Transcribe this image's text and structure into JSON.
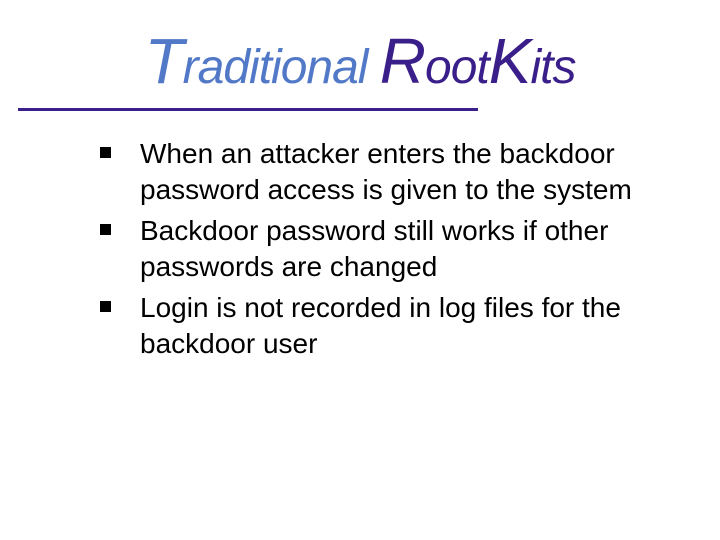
{
  "slide": {
    "title": {
      "word1_first": "T",
      "word1_rest": "raditional",
      "word2_first": "R",
      "word2_mid": "oot",
      "word2_cap2": "K",
      "word2_end": "its"
    },
    "bullets": [
      "When an attacker enters the backdoor password access is given to the system",
      "Backdoor password still works if other passwords are changed",
      "Login is not recorded in log files for the backdoor user"
    ]
  }
}
